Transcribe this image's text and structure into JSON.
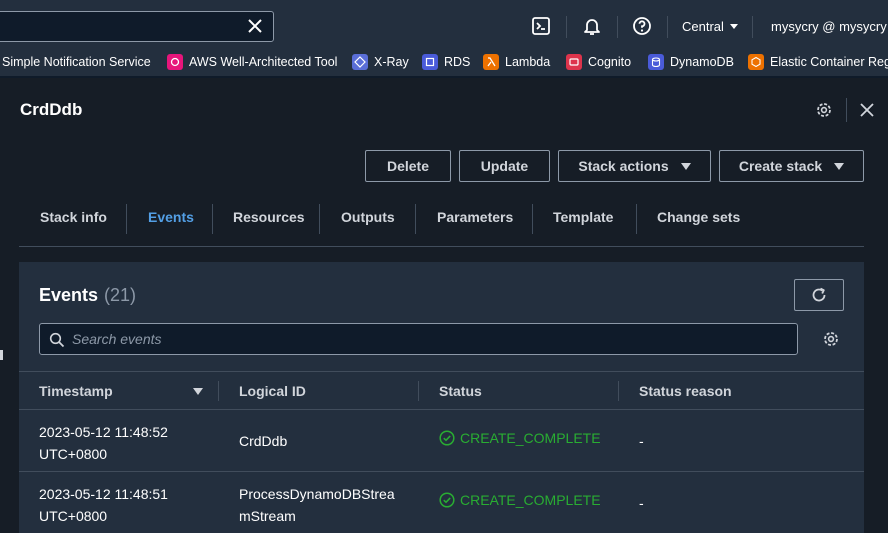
{
  "topbar": {
    "search_value": "",
    "region": "Central",
    "account": "mysycry @ mysycry"
  },
  "favorites": [
    {
      "label": "Simple Notification Service",
      "icon": "sns-icon",
      "color": ""
    },
    {
      "label": "AWS Well-Architected Tool",
      "icon": "well-architected-icon",
      "color": "#e7157b"
    },
    {
      "label": "X-Ray",
      "icon": "xray-icon",
      "color": "#5a6ed8"
    },
    {
      "label": "RDS",
      "icon": "rds-icon",
      "color": "#4a5bd9"
    },
    {
      "label": "Lambda",
      "icon": "lambda-icon",
      "color": "#ed7100"
    },
    {
      "label": "Cognito",
      "icon": "cognito-icon",
      "color": "#dd344c"
    },
    {
      "label": "DynamoDB",
      "icon": "dynamodb-icon",
      "color": "#4a5bd9"
    },
    {
      "label": "Elastic Container Reg",
      "icon": "ecr-icon",
      "color": "#ed7100"
    }
  ],
  "stack": {
    "name": "CrdDdb"
  },
  "actions": {
    "delete": "Delete",
    "update": "Update",
    "stack_actions": "Stack actions",
    "create_stack": "Create stack"
  },
  "tabs": [
    "Stack info",
    "Events",
    "Resources",
    "Outputs",
    "Parameters",
    "Template",
    "Change sets"
  ],
  "active_tab": "Events",
  "events": {
    "title": "Events",
    "count": "(21)",
    "search_placeholder": "Search events",
    "columns": [
      "Timestamp",
      "Logical ID",
      "Status",
      "Status reason"
    ],
    "rows": [
      {
        "timestamp_line1": "2023-05-12 11:48:52",
        "timestamp_line2": "UTC+0800",
        "logical_id_line1": "CrdDdb",
        "logical_id_line2": "",
        "status": "CREATE_COMPLETE",
        "reason": "-"
      },
      {
        "timestamp_line1": "2023-05-12 11:48:51",
        "timestamp_line2": "UTC+0800",
        "logical_id_line1": "ProcessDynamoDBStrea",
        "logical_id_line2": "mStream",
        "status": "CREATE_COMPLETE",
        "reason": "-"
      }
    ]
  },
  "colors": {
    "accent": "#539fe5",
    "success": "#29ad32",
    "nav_bg": "#232f3e"
  }
}
